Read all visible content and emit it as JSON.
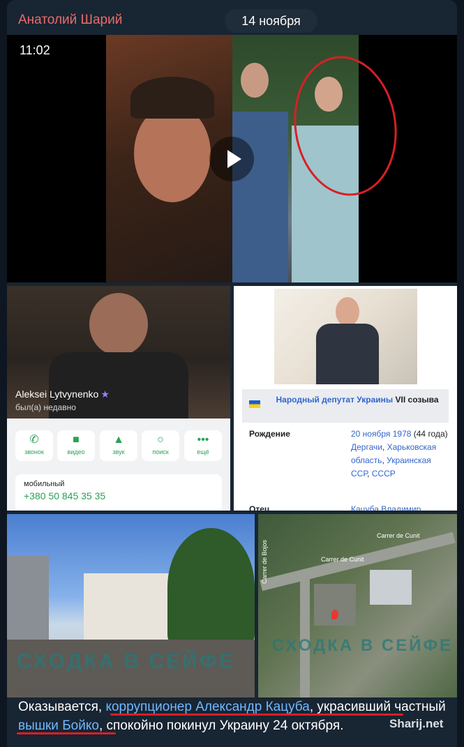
{
  "channel": {
    "sender_name": "Анатолий Шарий"
  },
  "date_pill": "14 ноября",
  "video": {
    "duration": "11:02"
  },
  "profile_screenshot": {
    "name": "Aleksei Lytvynenko",
    "status": "был(а) недавно",
    "actions": [
      {
        "icon": "phone-icon",
        "label": "звонок"
      },
      {
        "icon": "video-icon",
        "label": "видео"
      },
      {
        "icon": "bell-icon",
        "label": "звук"
      },
      {
        "icon": "search-icon",
        "label": "поиск"
      },
      {
        "icon": "more-icon",
        "label": "ещё"
      }
    ],
    "phone_label": "мобильный",
    "phone_number": "+380 50 845 35 35"
  },
  "wiki_screenshot": {
    "title_link": "Народный депутат Украины",
    "title_rest": "VII созыва",
    "birth_label": "Рождение",
    "birth_date": "20 ноября 1978",
    "birth_age": "(44 года)",
    "birth_place_1": "Дергачи",
    "birth_place_2": "Харьковская область",
    "birth_place_3": "Украинская ССР",
    "birth_place_4": "СССР",
    "next_label": "Отец",
    "next_value": "Кацуба Владимир"
  },
  "photos": {
    "watermark": "СХОДКА В СЕЙФЕ",
    "street_1": "Carrer de Cunit",
    "street_2": "Carrer de Cunit",
    "street_3": "Carrer de Bojos"
  },
  "caption": {
    "part1": "Оказывается, ",
    "link1": "коррупционер Александр Кацуба",
    "part2": ", украсивший ",
    "part3": "частный",
    "link2": "вышки Бойко",
    "part4": ", спокойно покинул Украину 24 октября."
  },
  "site_watermark": "Sharij.net",
  "colors": {
    "background": "#0e1621",
    "bubble": "#182533",
    "sender": "#e96b6b",
    "link": "#71b8ff",
    "marker": "#d81f26"
  }
}
